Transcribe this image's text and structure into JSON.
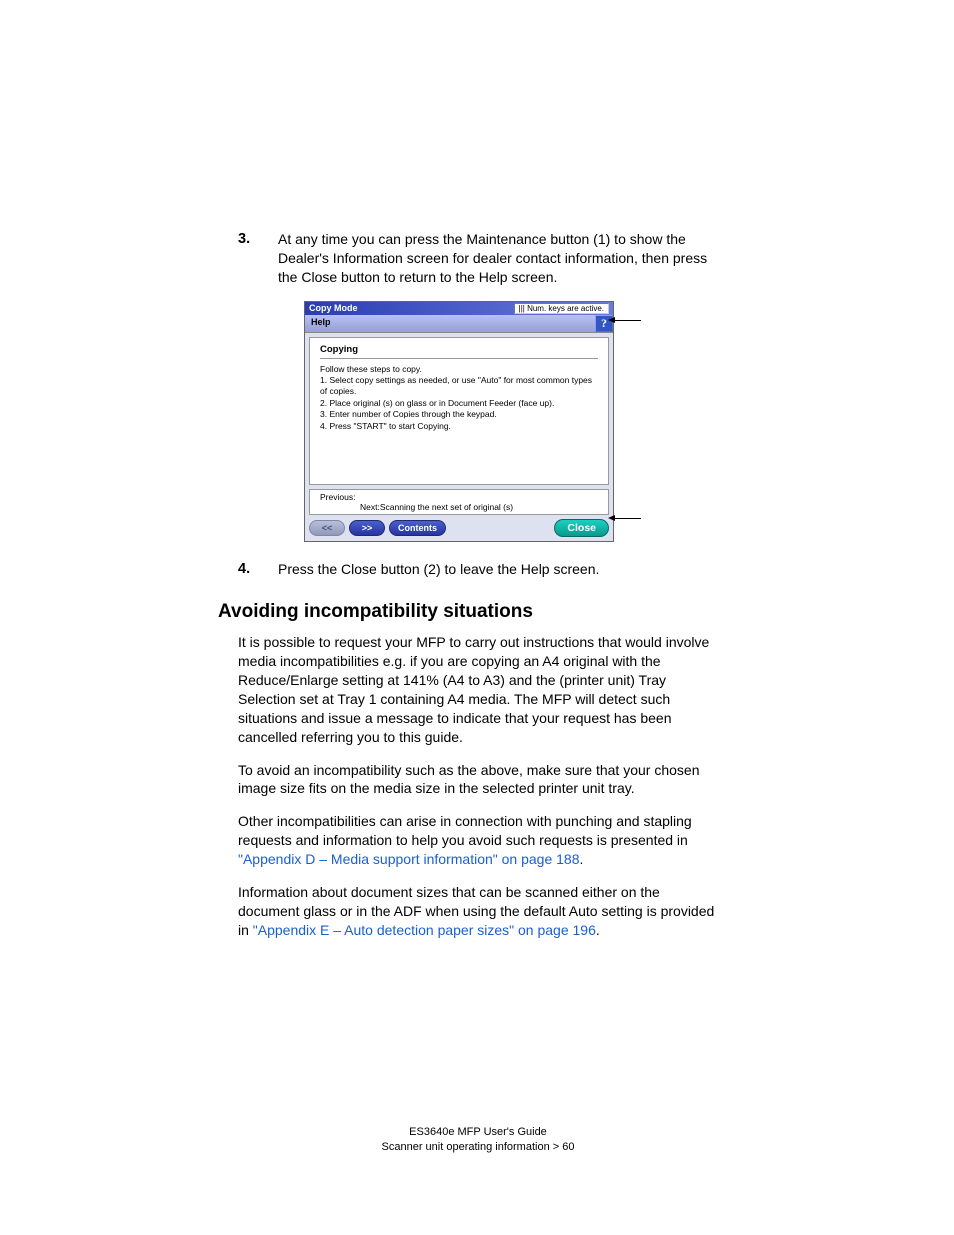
{
  "step3": {
    "num": "3.",
    "text": "At any time you can press the Maintenance button (1) to show the Dealer's Information screen for dealer contact information, then press the Close button to return to the Help screen."
  },
  "step4": {
    "num": "4.",
    "text": "Press the Close button (2) to leave the Help screen."
  },
  "shot": {
    "title": "Copy Mode",
    "status": "||| Num. keys are active.",
    "help_label": "Help",
    "section": "Copying",
    "lines": {
      "intro": "Follow these steps to copy.",
      "l1": "1. Select copy settings as needed, or use \"Auto\" for most common types of copies.",
      "l2": "2. Place original (s) on glass or in Document Feeder (face up).",
      "l3": "3. Enter number of Copies through the keypad.",
      "l4": "4. Press \"START\" to start Copying."
    },
    "prev": "Previous:",
    "next": "Next:Scanning the next set of original (s)",
    "btn_prev": "<<",
    "btn_next": ">>",
    "btn_contents": "Contents",
    "btn_close": "Close"
  },
  "heading": "Avoiding incompatibility situations",
  "p1": "It is possible to request your MFP to carry out instructions that would involve media incompatibilities e.g. if you are copying an A4 original with the Reduce/Enlarge setting at 141% (A4 to A3) and the (printer unit) Tray Selection set at Tray 1 containing A4 media. The MFP will detect such situations and issue a message to indicate that your request has been cancelled referring you to this guide.",
  "p2": "To avoid an incompatibility such as the above, make sure that your chosen image size fits on the media size in the selected printer unit tray.",
  "p3a": "Other incompatibilities can arise in connection with punching and stapling requests and information to help you avoid such requests is presented in ",
  "p3link": "\"Appendix D – Media support information\" on page 188",
  "p3b": ".",
  "p4a": "Information about document sizes that can be scanned either on the document glass or in the ADF when using the default Auto setting is provided in ",
  "p4link": "\"Appendix E – Auto detection paper sizes\" on page 196",
  "p4b": ".",
  "footer1": "ES3640e MFP User's Guide",
  "footer2": "Scanner unit operating information > 60"
}
